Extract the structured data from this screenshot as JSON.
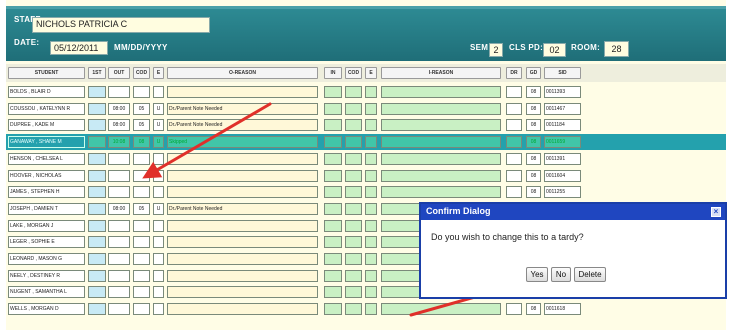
{
  "header": {
    "staff_label": "STAFF:",
    "staff_value": "NICHOLS PATRICIA C",
    "date_label": "DATE:",
    "date_value": "05/12/2011",
    "date_format": "MM/DD/YYYY",
    "sem_label": "SEM:",
    "sem_value": "2",
    "clspd_label": "CLS PD:",
    "clspd_value": "02",
    "room_label": "ROOM:",
    "room_value": "28"
  },
  "columns": {
    "student": "STUDENT",
    "first": "1ST",
    "out": "OUT",
    "cod": "COD",
    "e": "E",
    "oreason": "O-REASON",
    "in": "IN",
    "cod2": "COD",
    "e2": "E",
    "ireason": "I-REASON",
    "dr": "DR",
    "gd": "GD",
    "sid": "SID"
  },
  "rows": [
    {
      "student": "BOLDS , BLAIR D",
      "out": "",
      "cod": "",
      "e": "",
      "oreason": "",
      "gd": "08",
      "sid": "0011393"
    },
    {
      "student": "COUSSOU , KATELYNN R",
      "out": "08:00",
      "cod": "05",
      "e": "U",
      "oreason": "Dr./Parent Note Needed",
      "gd": "08",
      "sid": "0011467"
    },
    {
      "student": "DUPREE , KADE M",
      "out": "08:00",
      "cod": "05",
      "e": "U",
      "oreason": "Dr./Parent Note Needed",
      "gd": "08",
      "sid": "0011184"
    },
    {
      "student": "GANAWAY , SHANE M",
      "out": "10:08",
      "cod": "08",
      "e": "U",
      "oreason": "Skipped",
      "gd": "08",
      "sid": "0011659"
    },
    {
      "student": "HENSON , CHELSEA L",
      "out": "",
      "cod": "",
      "e": "",
      "oreason": "",
      "gd": "08",
      "sid": "0011391"
    },
    {
      "student": "HOOVER , NICHOLAS",
      "out": "",
      "cod": "",
      "e": "",
      "oreason": "",
      "gd": "08",
      "sid": "0011604"
    },
    {
      "student": "JAMES , STEPHEN H",
      "out": "",
      "cod": "",
      "e": "",
      "oreason": "",
      "gd": "08",
      "sid": "0011255"
    },
    {
      "student": "JOSEPH , DAMIEN T",
      "out": "08:00",
      "cod": "05",
      "e": "U",
      "oreason": "Dr./Parent Note Needed",
      "gd": "",
      "sid": ""
    },
    {
      "student": "LAKE , MORGAN J",
      "out": "",
      "cod": "",
      "e": "",
      "oreason": "",
      "gd": "",
      "sid": ""
    },
    {
      "student": "LEGER , SOPHIE E",
      "out": "",
      "cod": "",
      "e": "",
      "oreason": "",
      "gd": "",
      "sid": ""
    },
    {
      "student": "LEONARD , MASON G",
      "out": "",
      "cod": "",
      "e": "",
      "oreason": "",
      "gd": "",
      "sid": ""
    },
    {
      "student": "NEELY , DESTINEY R",
      "out": "",
      "cod": "",
      "e": "",
      "oreason": "",
      "gd": "",
      "sid": ""
    },
    {
      "student": "NUGENT , SAMANTHA L",
      "out": "",
      "cod": "",
      "e": "",
      "oreason": "",
      "gd": "",
      "sid": ""
    },
    {
      "student": "WELLS , MORGAN D",
      "out": "",
      "cod": "",
      "e": "",
      "oreason": "",
      "gd": "08",
      "sid": "0011618"
    }
  ],
  "dialog": {
    "title": "Confirm Dialog",
    "close": "×",
    "message": "Do you wish to change this to a tardy?",
    "yes": "Yes",
    "no": "No",
    "delete": "Delete"
  },
  "colors": {
    "header_teal": "#1f6e78",
    "highlight_row": "#24a1ad",
    "dialog_title_bar": "#1f46c0",
    "annotation_arrow": "#e0302a"
  }
}
